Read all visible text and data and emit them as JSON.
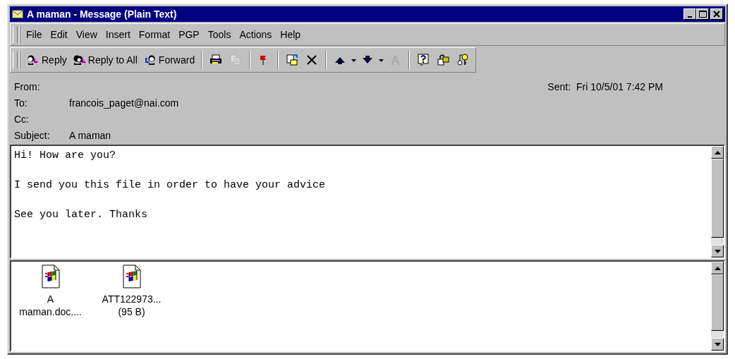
{
  "window": {
    "title": "A maman - Message (Plain Text)"
  },
  "menu": [
    "File",
    "Edit",
    "View",
    "Insert",
    "Format",
    "PGP",
    "Tools",
    "Actions",
    "Help"
  ],
  "toolbar": [
    {
      "kind": "button",
      "label": "Reply",
      "disabled": false
    },
    {
      "kind": "button",
      "label": "Reply to All",
      "disabled": false
    },
    {
      "kind": "button",
      "label": "Forward",
      "disabled": false
    },
    {
      "kind": "separator"
    },
    {
      "kind": "icon",
      "disabled": false
    },
    {
      "kind": "icon",
      "disabled": true
    },
    {
      "kind": "separator"
    },
    {
      "kind": "icon",
      "disabled": false
    },
    {
      "kind": "separator"
    },
    {
      "kind": "icon",
      "disabled": false
    },
    {
      "kind": "icon",
      "disabled": false
    },
    {
      "kind": "separator"
    },
    {
      "kind": "icon",
      "disabled": false
    },
    {
      "kind": "dropdown",
      "disabled": false
    },
    {
      "kind": "icon",
      "disabled": false
    },
    {
      "kind": "dropdown",
      "disabled": false
    },
    {
      "kind": "icon",
      "disabled": true
    },
    {
      "kind": "separator"
    },
    {
      "kind": "icon",
      "disabled": false
    },
    {
      "kind": "icon",
      "disabled": false
    },
    {
      "kind": "icon",
      "disabled": false
    }
  ],
  "header": {
    "from_label": "From:",
    "sent_label": "Sent:",
    "sent_value": "Fri 10/5/01 7:42 PM",
    "fields": [
      {
        "label": "To:",
        "value": "francois_paget@nai.com"
      },
      {
        "label": "Cc:"
      },
      {
        "label": "Subject:",
        "value": "A maman"
      }
    ]
  },
  "body": [
    "Hi! How are you?",
    "I send you this file in order to have your advice",
    "See you later. Thanks"
  ],
  "attachments": [
    {
      "name": "A maman.doc...."
    },
    {
      "name": "ATT122973... (95 B)"
    }
  ]
}
